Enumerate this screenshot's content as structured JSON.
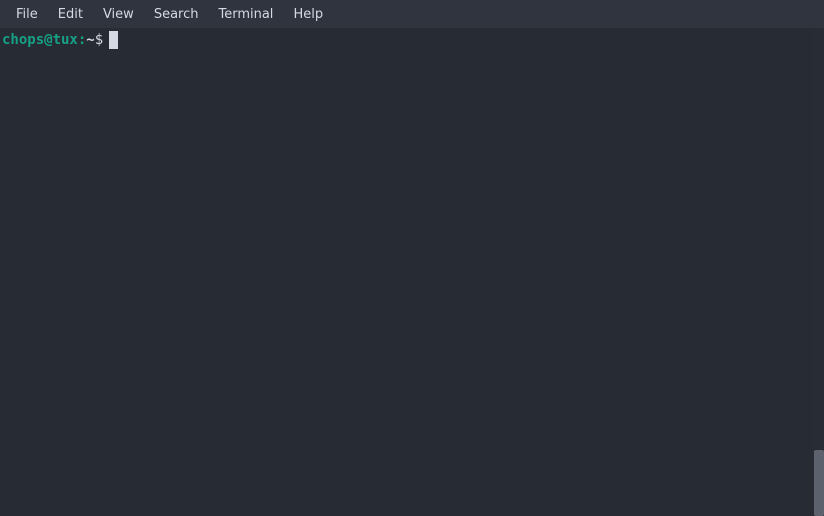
{
  "menubar": {
    "items": [
      {
        "label": "File"
      },
      {
        "label": "Edit"
      },
      {
        "label": "View"
      },
      {
        "label": "Search"
      },
      {
        "label": "Terminal"
      },
      {
        "label": "Help"
      }
    ]
  },
  "terminal": {
    "prompt": {
      "userhost": "chops@tux:",
      "path": "~",
      "symbol": "$"
    },
    "input_value": ""
  },
  "colors": {
    "background": "#272b33",
    "menubar_bg": "#2f343f",
    "prompt_userhost": "#16a085",
    "text": "#d3dae3"
  }
}
